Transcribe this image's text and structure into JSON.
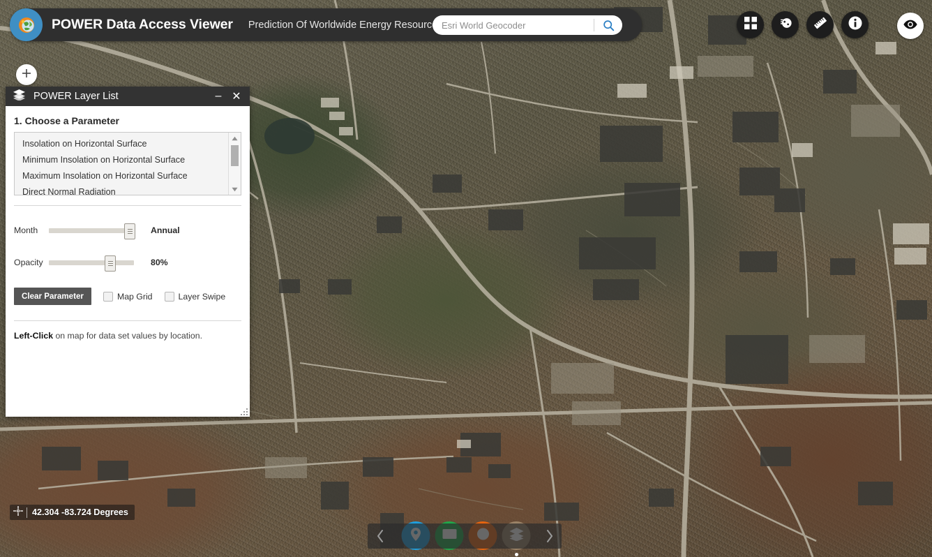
{
  "header": {
    "logo_icon": "power-sun-globe-logo",
    "title": "POWER Data Access Viewer",
    "subtitle": "Prediction Of Worldwide Energy Resource",
    "search": {
      "placeholder": "Esri World Geocoder",
      "value": "",
      "search_icon": "search-icon"
    },
    "tools": [
      {
        "name": "widget-grid",
        "icon": "grid-squares-icon",
        "style": "dark"
      },
      {
        "name": "basemap-gallery",
        "icon": "basemap-globe-icon",
        "style": "dark"
      },
      {
        "name": "measure",
        "icon": "ruler-icon",
        "style": "dark"
      },
      {
        "name": "about-info",
        "icon": "info-icon",
        "style": "dark"
      },
      {
        "name": "preview-toggle",
        "icon": "eye-icon",
        "style": "light"
      }
    ]
  },
  "add_layer_button": {
    "label": "+",
    "icon": "plus-icon"
  },
  "panel": {
    "icon": "layers-stack-icon",
    "title": "POWER Layer List",
    "minimize_label": "–",
    "close_label": "✕",
    "section_title": "1. Choose a Parameter",
    "parameters": [
      "Insolation on Horizontal Surface",
      "Minimum Insolation on Horizontal Surface",
      "Maximum Insolation on Horizontal Surface",
      "Direct Normal Radiation"
    ],
    "selected_parameter": "",
    "sliders": [
      {
        "name": "month",
        "label": "Month",
        "value_text": "Annual",
        "percent": 100
      },
      {
        "name": "opacity",
        "label": "Opacity",
        "value_text": "80%",
        "percent": 74
      }
    ],
    "clear_button_label": "Clear Parameter",
    "checkboxes": [
      {
        "name": "map-grid",
        "label": "Map Grid",
        "checked": false
      },
      {
        "name": "layer-swipe",
        "label": "Layer Swipe",
        "checked": false
      }
    ],
    "hint_bold": "Left-Click",
    "hint_rest": " on map for data set values by location."
  },
  "map": {
    "coordinates": "42.304 -83.724 Degrees",
    "coordinates_icon": "crosshair-icon"
  },
  "bottom_toolbar": {
    "prev_icon": "chevron-left-icon",
    "next_icon": "chevron-right-icon",
    "buttons": [
      {
        "name": "location-pin-tool",
        "icon": "map-pin-icon",
        "color": "#1fa0e0",
        "active": false
      },
      {
        "name": "rectangle-select-tool",
        "icon": "rectangle-icon",
        "color": "#1fa84a",
        "active": false
      },
      {
        "name": "circle-select-tool",
        "icon": "circle-icon",
        "color": "#e8650f",
        "active": false
      },
      {
        "name": "layers-tool",
        "icon": "layers-stack-icon",
        "color": "#9c8468",
        "active": true
      }
    ]
  },
  "colors": {
    "header_bg": "#2f2f2f",
    "panel_titlebar": "#333333",
    "accent_blue": "#3f8fc4",
    "clear_button": "#555555",
    "search_icon": "#2b7fc4"
  }
}
